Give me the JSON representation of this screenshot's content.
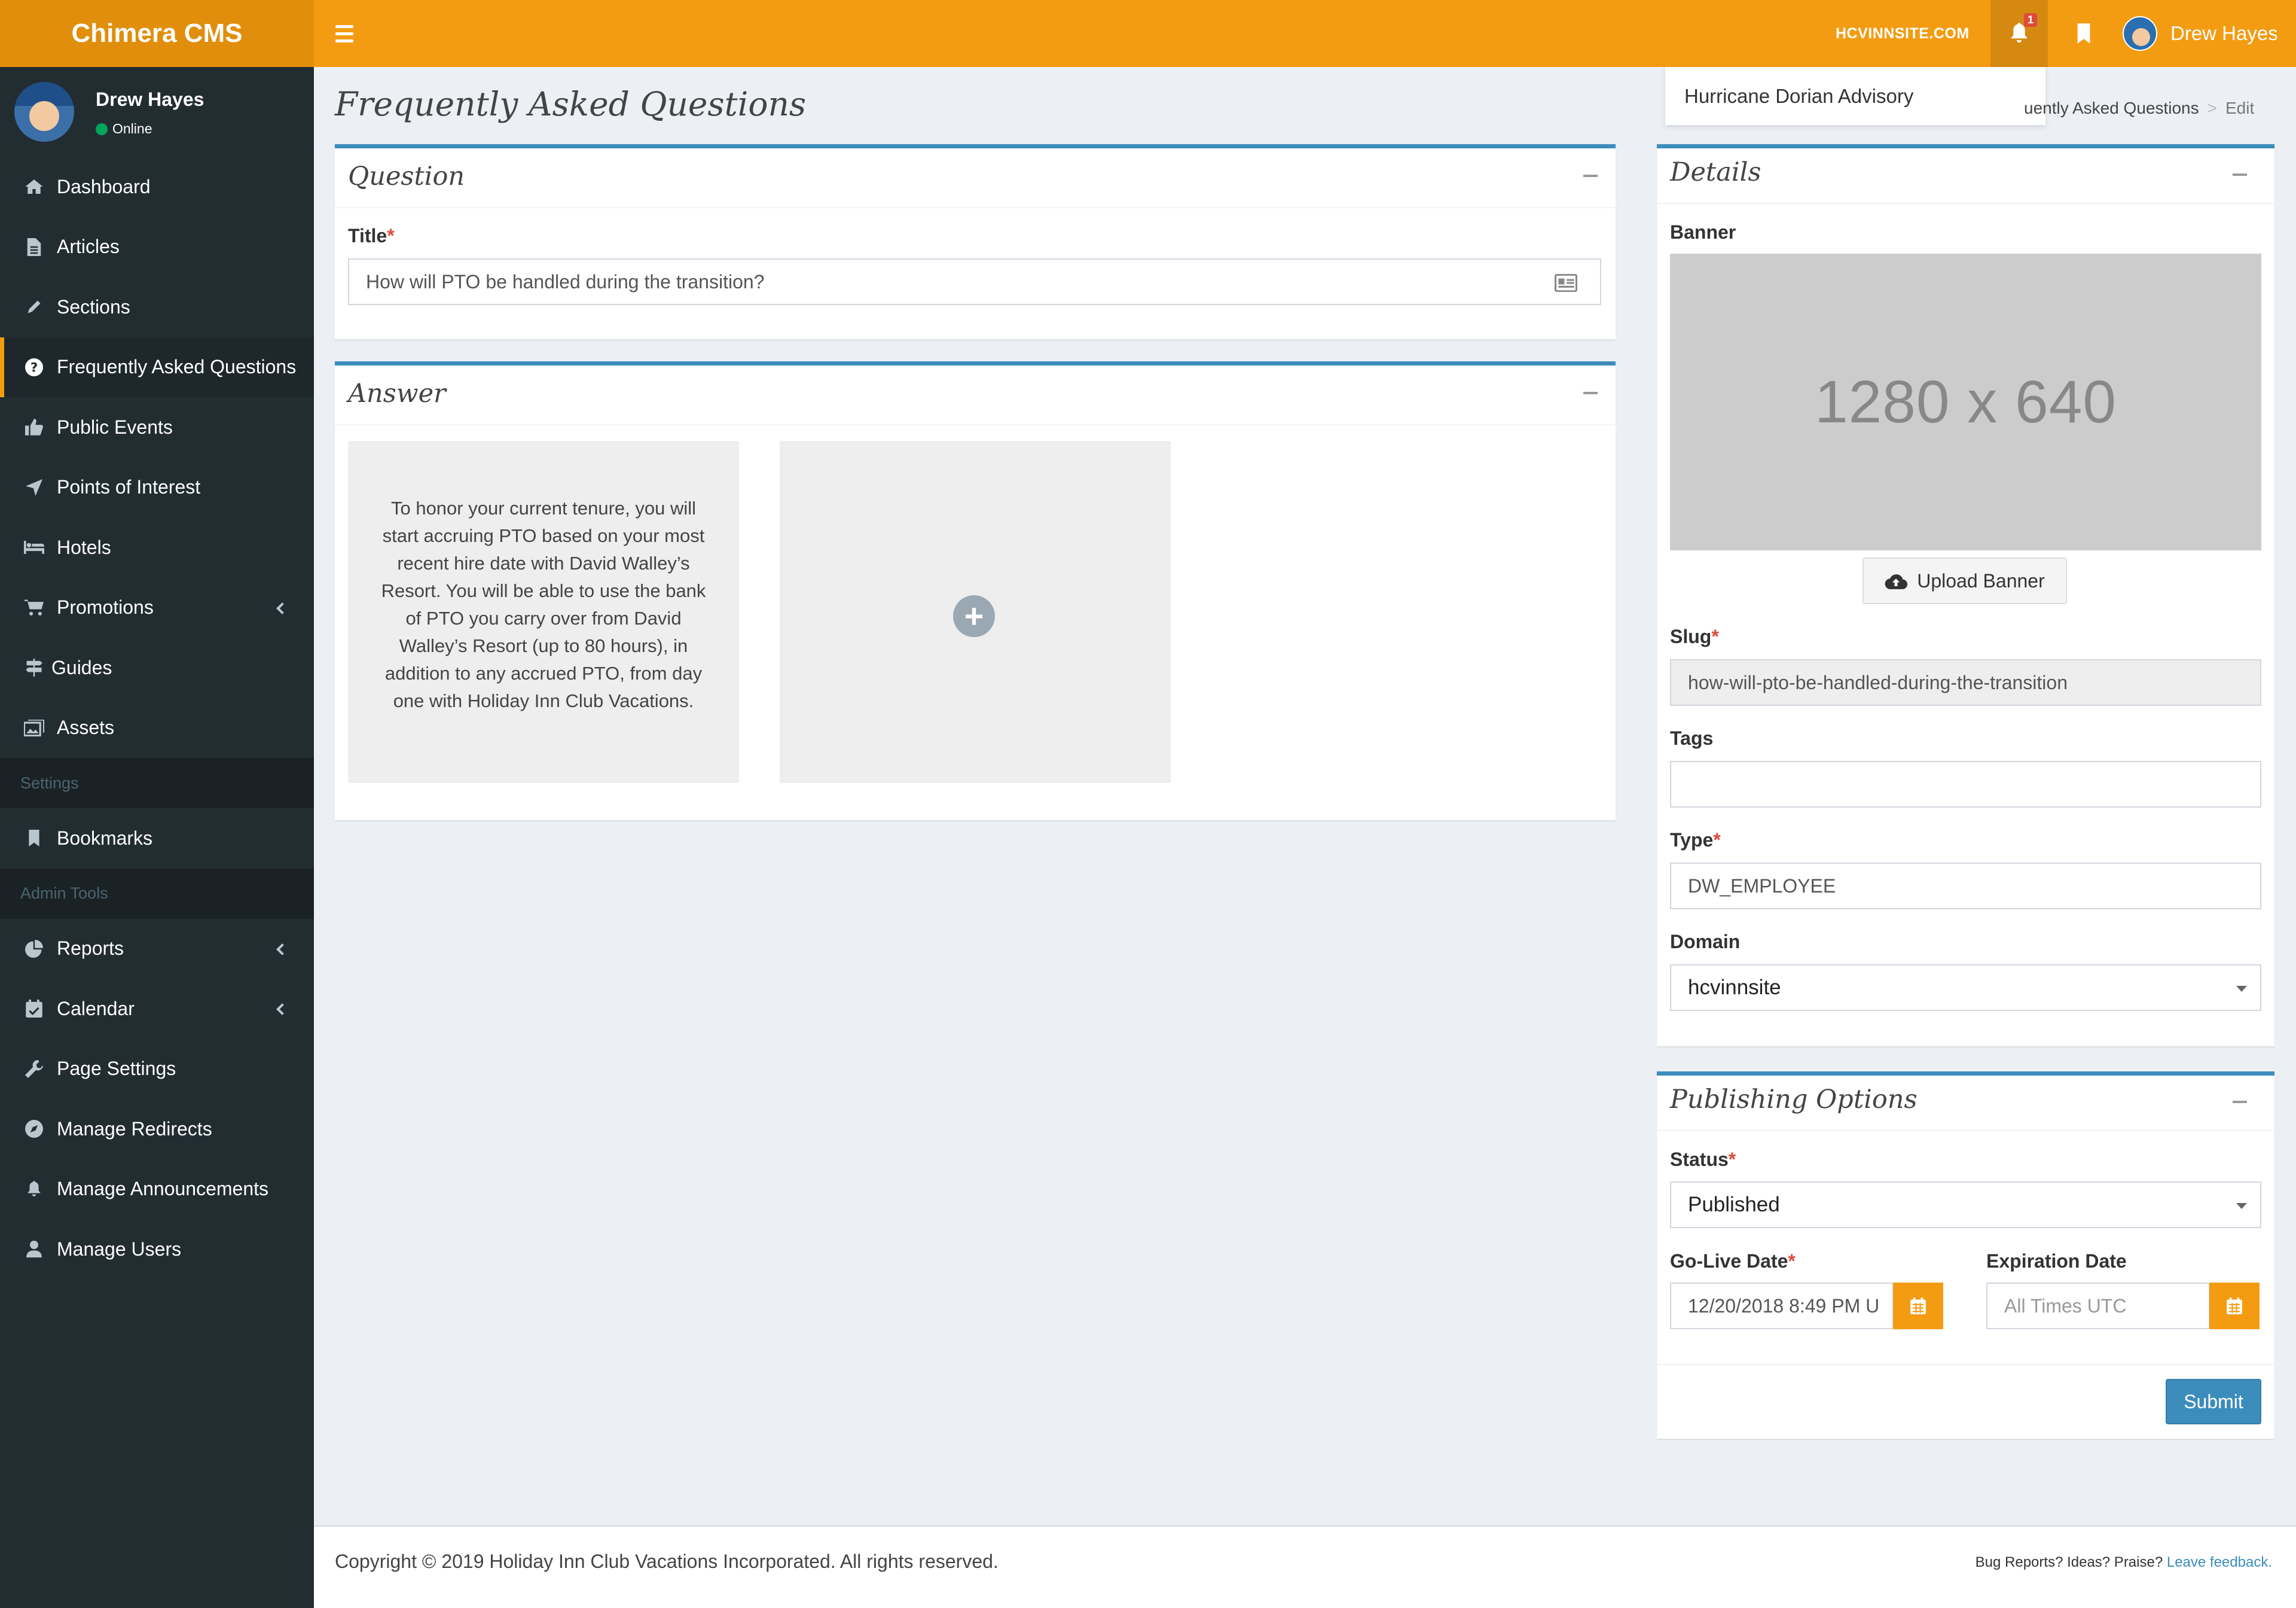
{
  "header": {
    "logo": "Chimera CMS",
    "domain_link": "HCVINNSITE.COM",
    "notification_count": "1",
    "user_name": "Drew Hayes"
  },
  "notification_dropdown": {
    "item": "Hurricane Dorian Advisory"
  },
  "sidebar": {
    "user_name": "Drew Hayes",
    "status": "Online",
    "items_main": [
      {
        "label": "Dashboard",
        "icon": "home-icon"
      },
      {
        "label": "Articles",
        "icon": "file-icon"
      },
      {
        "label": "Sections",
        "icon": "pencil-icon"
      },
      {
        "label": "Frequently Asked Questions",
        "icon": "question-circle-icon"
      },
      {
        "label": "Public Events",
        "icon": "thumbs-up-icon"
      },
      {
        "label": "Points of Interest",
        "icon": "location-arrow-icon"
      },
      {
        "label": "Hotels",
        "icon": "bed-icon"
      },
      {
        "label": "Promotions",
        "icon": "cart-icon"
      },
      {
        "label": "Guides",
        "icon": "signpost-icon"
      },
      {
        "label": "Assets",
        "icon": "images-icon"
      }
    ],
    "settings_header": "Settings",
    "items_settings": [
      {
        "label": "Bookmarks",
        "icon": "bookmark-icon"
      }
    ],
    "admin_header": "Admin Tools",
    "items_admin": [
      {
        "label": "Reports",
        "icon": "pie-chart-icon"
      },
      {
        "label": "Calendar",
        "icon": "calendar-check-icon"
      },
      {
        "label": "Page Settings",
        "icon": "wrench-icon"
      },
      {
        "label": "Manage Redirects",
        "icon": "compass-icon"
      },
      {
        "label": "Manage Announcements",
        "icon": "bell-icon"
      },
      {
        "label": "Manage Users",
        "icon": "user-icon"
      }
    ]
  },
  "page": {
    "title": "Frequently Asked Questions",
    "breadcrumb_current_section": "uently Asked Questions",
    "breadcrumb_sep": ">",
    "breadcrumb_page": "Edit"
  },
  "question_box": {
    "title": "Question",
    "title_label": "Title",
    "title_value": "How will PTO be handled during the transition?"
  },
  "answer_box": {
    "title": "Answer",
    "answer_text": "To honor your current tenure, you will start accruing PTO based on your most recent hire date with David Walley’s Resort. You will be able to use the bank of PTO you carry over from David Walley’s Resort (up to 80 hours), in addition to any accrued PTO, from day one with Holiday Inn Club Vacations."
  },
  "details_box": {
    "title": "Details",
    "banner_label": "Banner",
    "banner_placeholder": "1280 x 640",
    "upload_label": "Upload Banner",
    "slug_label": "Slug",
    "slug_value": "how-will-pto-be-handled-during-the-transition",
    "tags_label": "Tags",
    "tags_value": "",
    "type_label": "Type",
    "type_value": "DW_EMPLOYEE",
    "domain_label": "Domain",
    "domain_value": "hcvinnsite"
  },
  "publishing_box": {
    "title": "Publishing Options",
    "status_label": "Status",
    "status_value": "Published",
    "golive_label": "Go-Live Date",
    "golive_value": "12/20/2018 8:49 PM U",
    "expiration_label": "Expiration Date",
    "expiration_placeholder": "All Times UTC",
    "submit_label": "Submit"
  },
  "footer": {
    "copyright": "Copyright © 2019 Holiday Inn Club Vacations Incorporated. All rights reserved.",
    "feedback_prefix": "Bug Reports? Ideas? Praise?",
    "feedback_link": "Leave feedback."
  },
  "colors": {
    "accent": "#f39c12",
    "sidebar": "#222d32",
    "primary": "#3c8dbc"
  }
}
